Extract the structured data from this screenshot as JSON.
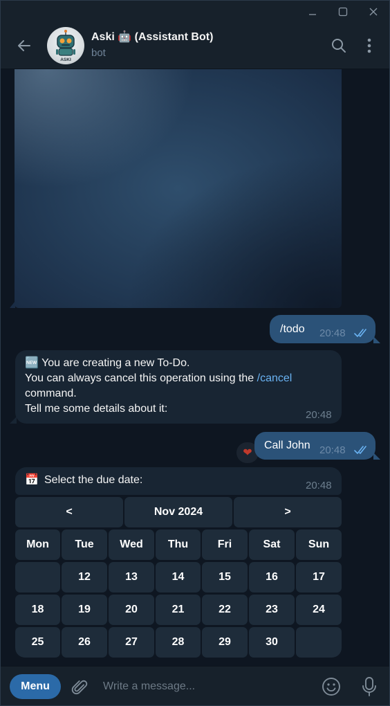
{
  "window": {
    "controls": {
      "minimize": "minimize-icon",
      "maximize": "maximize-icon",
      "close": "close-icon"
    }
  },
  "header": {
    "title": "Aski 🤖 (Assistant Bot)",
    "subtitle": "bot",
    "avatar_text": "ASKI",
    "icons": {
      "back": "arrow-left-icon",
      "search": "search-icon",
      "more": "more-vertical-icon"
    }
  },
  "messages": [
    {
      "id": "m1",
      "direction": "outgoing",
      "text": "/todo",
      "time": "20:48",
      "status": "read"
    },
    {
      "id": "m2",
      "direction": "incoming",
      "emoji": "🆕",
      "line1": "You are creating a new To-Do.",
      "line2_prefix": "You can always cancel this operation using the ",
      "line2_link": "/cancel",
      "line3": "command.",
      "line4": "Tell me some details about it:",
      "time": "20:48"
    },
    {
      "id": "m3",
      "direction": "outgoing",
      "text": "Call John",
      "time": "20:48",
      "status": "read",
      "reaction": "❤"
    },
    {
      "id": "m4",
      "direction": "incoming",
      "emoji": "📅",
      "text": "Select the due date:",
      "time": "20:48"
    }
  ],
  "calendar": {
    "prev": "<",
    "month": "Nov 2024",
    "next": ">",
    "weekdays": [
      "Mon",
      "Tue",
      "Wed",
      "Thu",
      "Fri",
      "Sat",
      "Sun"
    ],
    "weeks": [
      [
        "",
        "12",
        "13",
        "14",
        "15",
        "16",
        "17"
      ],
      [
        "18",
        "19",
        "20",
        "21",
        "22",
        "23",
        "24"
      ],
      [
        "25",
        "26",
        "27",
        "28",
        "29",
        "30",
        ""
      ]
    ]
  },
  "composer": {
    "menu_label": "Menu",
    "placeholder": "Write a message...",
    "icons": {
      "attach": "paperclip-icon",
      "emoji": "emoji-icon",
      "mic": "microphone-icon"
    }
  },
  "colors": {
    "background": "#0e1621",
    "panel": "#17212b",
    "outgoing_bubble": "#2b5278",
    "incoming_bubble": "#182533",
    "accent": "#6ab3f3",
    "menu_button": "#2b6aa8"
  }
}
